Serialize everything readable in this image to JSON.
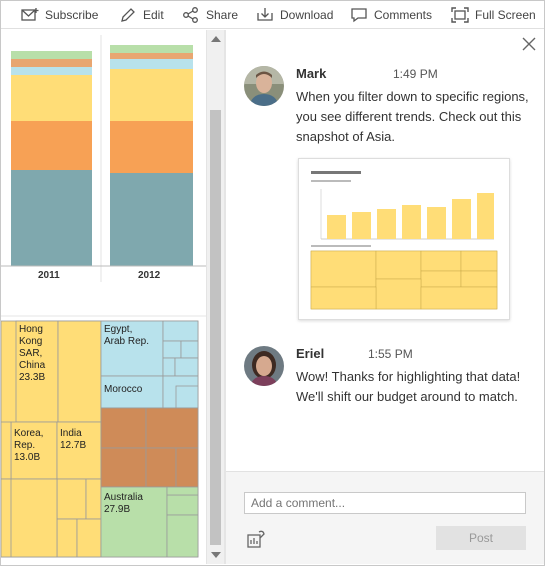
{
  "toolbar": {
    "subscribe_label": "Subscribe",
    "edit_label": "Edit",
    "share_label": "Share",
    "download_label": "Download",
    "comments_label": "Comments",
    "fullscreen_label": "Full Screen"
  },
  "viz": {
    "bar_years": [
      "2011",
      "2012"
    ],
    "treemap_labels": {
      "hongkong": "Hong\nKong\nSAR,\nChina\n23.3B",
      "egypt": "Egypt,\nArab Rep.",
      "morocco": "Morocco",
      "korea": "Korea,\nRep.\n13.0B",
      "india": "India\n12.7B",
      "australia": "Australia\n27.9B"
    },
    "colors": {
      "teal": "#7fa8ae",
      "orange": "#f7a155",
      "yellow": "#ffdd77",
      "lightblue": "#b8e2ec",
      "peach": "#e8a671",
      "green": "#b8dfa9",
      "brown": "#cf8b58"
    }
  },
  "comments": [
    {
      "name": "Mark",
      "time": "1:49 PM",
      "text": "When you filter down to specific regions, you see different trends. Check out this snapshot of Asia."
    },
    {
      "name": "Eriel",
      "time": "1:55 PM",
      "text": "Wow! Thanks for highlighting that data! We'll shift our budget around to match."
    }
  ],
  "composer": {
    "placeholder": "Add a comment...",
    "post_label": "Post"
  }
}
